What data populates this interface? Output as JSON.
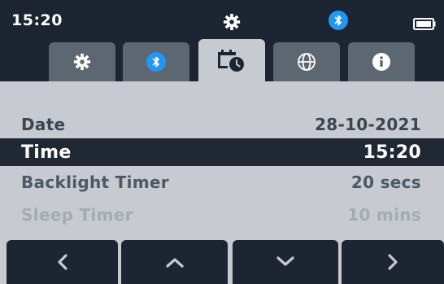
{
  "status": {
    "time": "15:20",
    "icons": [
      "gear-icon",
      "bluetooth-icon",
      "battery-icon"
    ]
  },
  "tabs": [
    {
      "name": "settings",
      "icon": "gear-icon",
      "active": false
    },
    {
      "name": "bluetooth",
      "icon": "bluetooth-icon",
      "active": false
    },
    {
      "name": "date-time",
      "icon": "calendar-clock-icon",
      "active": true
    },
    {
      "name": "language",
      "icon": "globe-icon",
      "active": false
    },
    {
      "name": "info",
      "icon": "info-icon",
      "active": false
    }
  ],
  "settings": {
    "date_label": "Date",
    "date_value": "28-10-2021",
    "time_label": "Time",
    "time_value": "15:20",
    "backlight_label": "Backlight Timer",
    "backlight_value": "20 secs",
    "sleep_label": "Sleep Timer",
    "sleep_value": "10 mins"
  },
  "nav": [
    "chevron-left-icon",
    "chevron-up-icon",
    "chevron-down-icon",
    "chevron-right-icon"
  ],
  "colors": {
    "background": "#1c2531",
    "panel": "#c7cbd1",
    "tab_inactive": "#5d6771",
    "accent_bluetooth": "#2196f3",
    "selected_row": "#202933"
  }
}
